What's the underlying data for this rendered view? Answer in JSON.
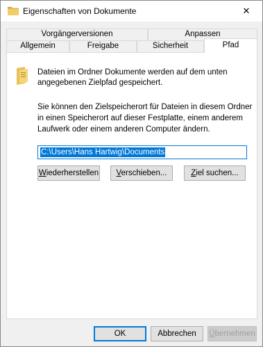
{
  "window": {
    "title": "Eigenschaften von Dokumente",
    "close_glyph": "✕"
  },
  "tabs": {
    "row1": [
      {
        "label": "Vorgängerversionen"
      },
      {
        "label": "Anpassen"
      }
    ],
    "row2": [
      {
        "label": "Allgemein"
      },
      {
        "label": "Freigabe"
      },
      {
        "label": "Sicherheit"
      },
      {
        "label": "Pfad",
        "active": true
      }
    ]
  },
  "path_tab": {
    "description": "Dateien im Ordner Dokumente werden auf dem unten angegebenen Zielpfad gespeichert.",
    "info": "Sie können den Zielspeicherort für Dateien in diesem Ordner in einen Speicherort auf dieser Festplatte, einem anderem Laufwerk oder einem anderen Computer ändern.",
    "path_value": "C:\\Users\\Hans Hartwig\\Documents",
    "buttons": {
      "restore": {
        "mnemonic": "W",
        "rest": "iederherstellen"
      },
      "move": {
        "mnemonic": "V",
        "rest": "erschieben..."
      },
      "find_target": {
        "mnemonic": "Z",
        "rest": "iel suchen..."
      }
    }
  },
  "dialog_buttons": {
    "ok": "OK",
    "cancel": "Abbrechen",
    "apply": {
      "mnemonic": "Ü",
      "rest": "bernehmen",
      "disabled": true
    }
  },
  "colors": {
    "accent": "#0078d7",
    "folder": "#e8c15a"
  }
}
